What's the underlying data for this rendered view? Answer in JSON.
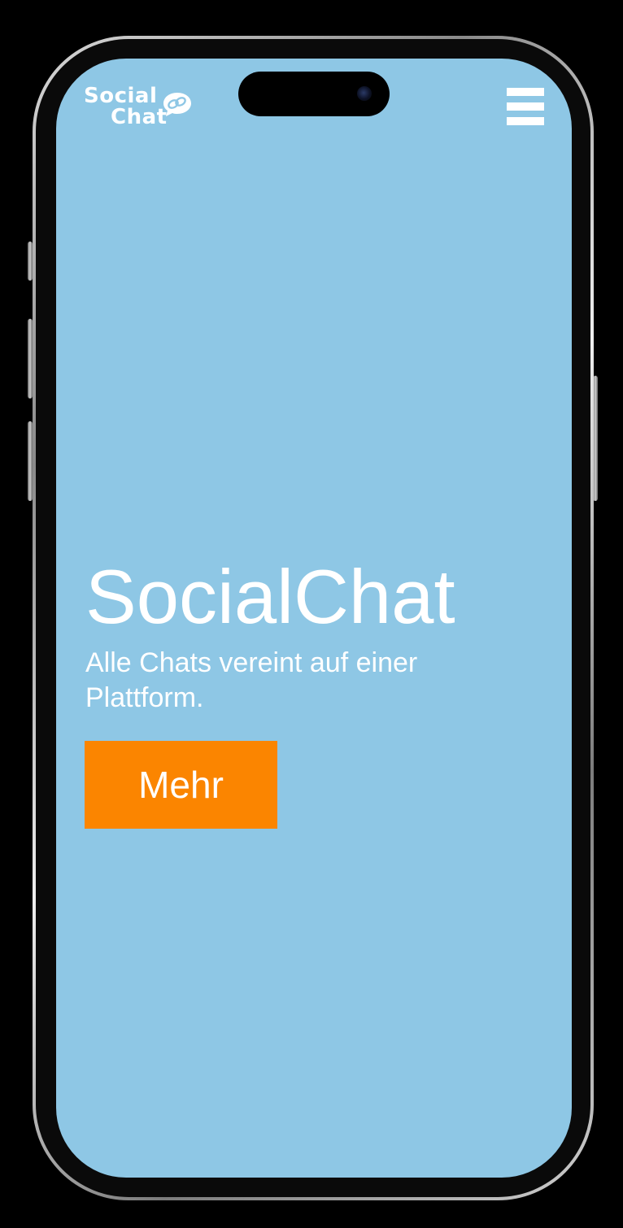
{
  "app": {
    "logo_line1": "Social",
    "logo_line2": "Chat"
  },
  "header": {
    "menu_icon": "hamburger-menu-icon"
  },
  "hero": {
    "title": "SocialChat",
    "subtitle": "Alle Chats vereint auf einer Plattform.",
    "cta_label": "Mehr"
  },
  "colors": {
    "background": "#8ec7e5",
    "accent": "#fb8500",
    "text": "#ffffff"
  }
}
